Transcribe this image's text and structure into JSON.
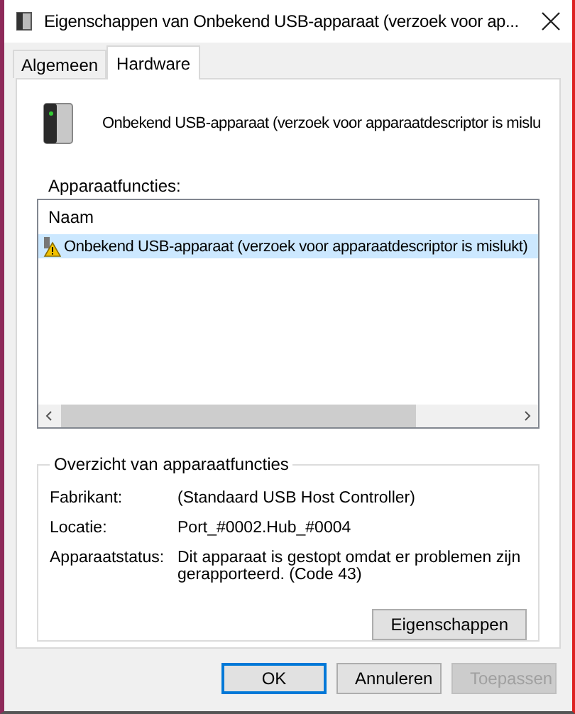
{
  "window": {
    "title": "Eigenschappen van Onbekend USB-apparaat (verzoek voor ap..."
  },
  "tabs": [
    {
      "label": "Algemeen",
      "selected": false
    },
    {
      "label": "Hardware",
      "selected": true
    }
  ],
  "device_name": "Onbekend USB-apparaat (verzoek voor apparaatdescriptor is mislu",
  "functions": {
    "label": "Apparaatfuncties:",
    "columns": [
      "Naam"
    ],
    "rows": [
      {
        "name": "Onbekend USB-apparaat (verzoek voor apparaatdescriptor is mislukt)",
        "selected": true,
        "warning": true
      }
    ]
  },
  "summary": {
    "title": "Overzicht van apparaatfuncties",
    "fields": [
      {
        "label": "Fabrikant:",
        "value": "(Standaard USB Host Controller)"
      },
      {
        "label": "Locatie:",
        "value": "Port_#0002.Hub_#0004"
      },
      {
        "label": "Apparaatstatus:",
        "value": "Dit apparaat is gestopt omdat er problemen zijn gerapporteerd. (Code 43)"
      }
    ],
    "button": "Eigenschappen"
  },
  "buttons": [
    {
      "label": "OK",
      "default": true,
      "disabled": false
    },
    {
      "label": "Annuleren",
      "default": false,
      "disabled": false
    },
    {
      "label": "Toepassen",
      "default": false,
      "disabled": true
    }
  ]
}
